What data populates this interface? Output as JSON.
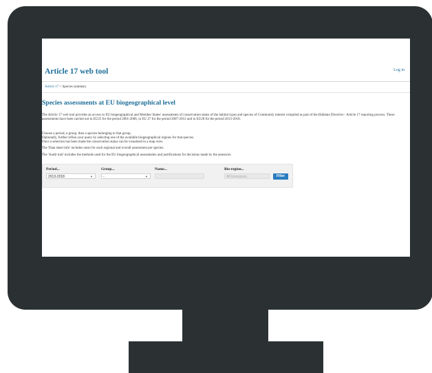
{
  "site": {
    "title": "Article 17 web tool",
    "login_label": "Log in"
  },
  "breadcrumb": {
    "root": "Article 17",
    "separator": " > ",
    "current": "Species summary"
  },
  "page": {
    "title": "Species assessments at EU biogeographical level",
    "intro": "The Article 17 web tool provides an access to EU biogeographical and Member States' assessments of conservation status of the habitat types and species of Community interest compiled as part of the Habitats Directive - Article 17 reporting process. These assessments have been carried out in EU25 for the period 2001-2006, in EU 27 for the period 2007-2012 and in EU28 for the period 2013-2018.",
    "steps": [
      "Choose a period, a group, then a species belonging to that group.",
      "Optionally, further refine your query by selecting one of the available biogeographical regions for that species.",
      "Once a selection has been made the conservation status can be visualised in a map view."
    ],
    "datasheet_note": "The 'Data sheet info' includes notes for each regional and overall assessment per species.",
    "audit_note": "The 'Audit trail' includes the methods used for the EU biogeographical assessments and justifications for decisions made by the assessors."
  },
  "filters": {
    "period": {
      "label": "Period...",
      "value": "2013-2018"
    },
    "group": {
      "label": "Group...",
      "value": "-"
    },
    "name": {
      "label": "Name...",
      "value": ""
    },
    "bioregion": {
      "label": "Bio-region...",
      "placeholder": "All bioregions"
    },
    "filter_button": "Filter"
  },
  "colors": {
    "accent": "#1d6e99",
    "button": "#2a7cc0",
    "monitor": "#2b3133"
  }
}
